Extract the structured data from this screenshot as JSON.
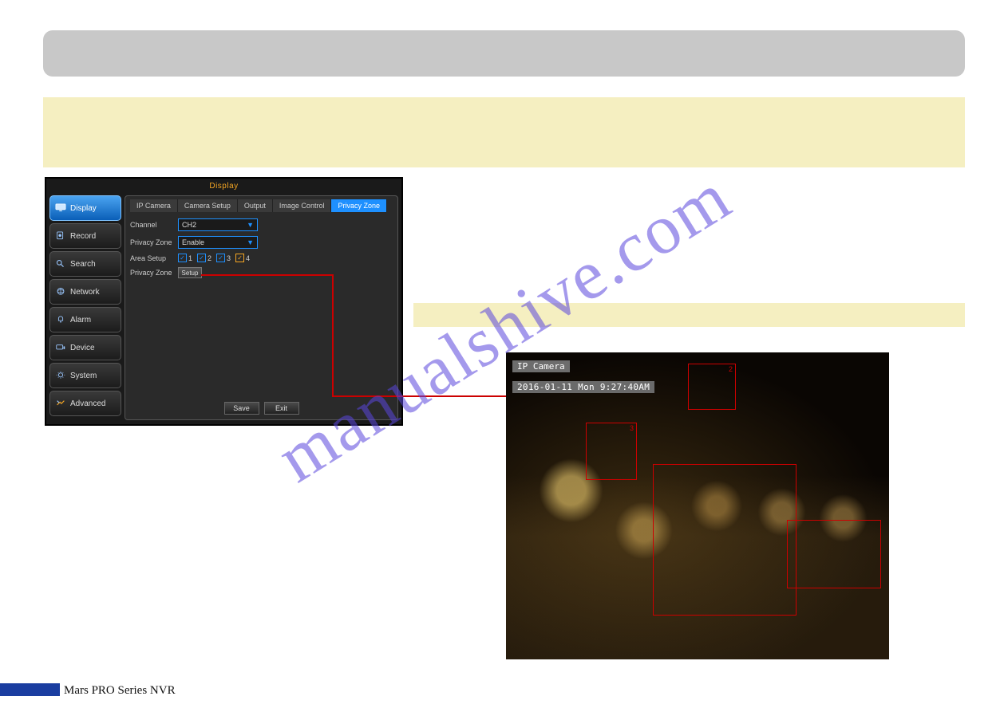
{
  "watermark": "manualshive.com",
  "footer": "Mars PRO Series NVR",
  "nvr": {
    "window_title": "Display",
    "sidebar": [
      {
        "label": "Display",
        "icon": "monitor-icon",
        "active": true
      },
      {
        "label": "Record",
        "icon": "record-icon",
        "active": false
      },
      {
        "label": "Search",
        "icon": "search-icon",
        "active": false
      },
      {
        "label": "Network",
        "icon": "network-icon",
        "active": false
      },
      {
        "label": "Alarm",
        "icon": "alarm-icon",
        "active": false
      },
      {
        "label": "Device",
        "icon": "device-icon",
        "active": false
      },
      {
        "label": "System",
        "icon": "system-icon",
        "active": false
      },
      {
        "label": "Advanced",
        "icon": "advanced-icon",
        "active": false
      }
    ],
    "tabs": [
      {
        "label": "IP Camera",
        "active": false
      },
      {
        "label": "Camera Setup",
        "active": false
      },
      {
        "label": "Output",
        "active": false
      },
      {
        "label": "Image Control",
        "active": false
      },
      {
        "label": "Privacy Zone",
        "active": true
      }
    ],
    "form": {
      "channel_label": "Channel",
      "channel_value": "CH2",
      "privacy_zone_label": "Privacy Zone",
      "privacy_zone_value": "Enable",
      "area_setup_label": "Area Setup",
      "area_checks": [
        "1",
        "2",
        "3",
        "4"
      ],
      "privacy_zone_setup_label": "Privacy Zone",
      "setup_button": "Setup"
    },
    "buttons": {
      "save": "Save",
      "exit": "Exit"
    }
  },
  "camera_preview": {
    "overlay_label": "IP Camera",
    "timestamp": "2016-01-11 Mon 9:27:40AM",
    "zones": [
      "2",
      "3"
    ]
  }
}
